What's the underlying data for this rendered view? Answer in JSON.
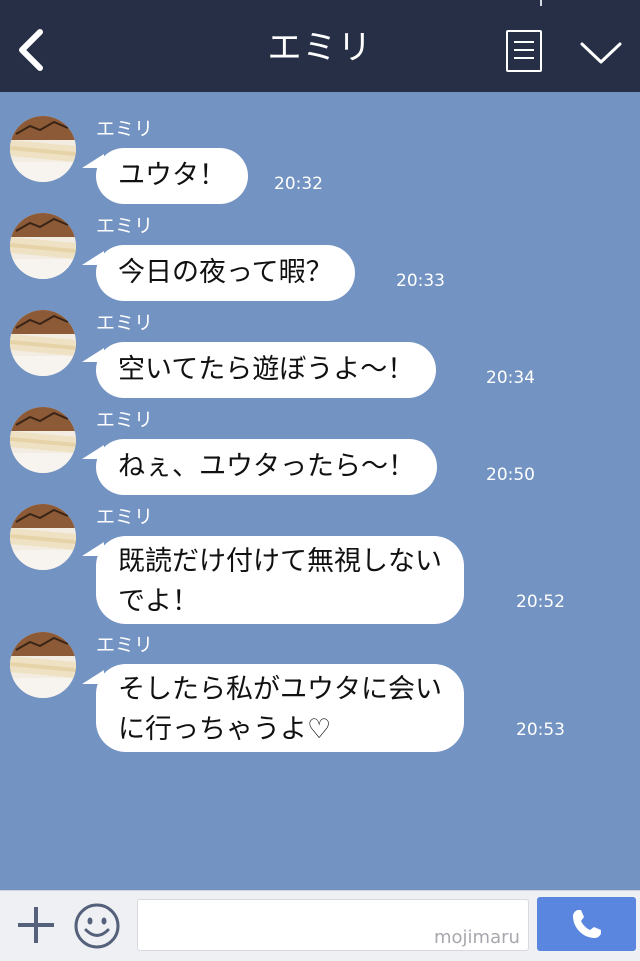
{
  "header": {
    "back_icon": "chevron-left-icon",
    "title": "エミリ",
    "note_icon": "note-icon",
    "collapse_icon": "chevron-down-icon"
  },
  "messages": [
    {
      "sender": "エミリ",
      "text": "ユウタ！",
      "time": "20:32"
    },
    {
      "sender": "エミリ",
      "text": "今日の夜って暇？",
      "time": "20:33"
    },
    {
      "sender": "エミリ",
      "text": "空いてたら遊ぼうよ〜！",
      "time": "20:34"
    },
    {
      "sender": "エミリ",
      "text": "ねぇ、ユウタったら〜！",
      "time": "20:50"
    },
    {
      "sender": "エミリ",
      "text": "既読だけ付けて無視しない\nでよ！",
      "time": "20:52"
    },
    {
      "sender": "エミリ",
      "text": "そしたら私がユウタに会い\nに行っちゃうよ♡",
      "time": "20:53"
    }
  ],
  "footer": {
    "plus_icon": "plus-icon",
    "emoji_icon": "smiley-icon",
    "input_value": "",
    "watermark": "mojimaru",
    "call_icon": "phone-icon"
  },
  "colors": {
    "header_bg": "#262f45",
    "chat_bg": "#7393c2",
    "call_button": "#5b86e0"
  }
}
